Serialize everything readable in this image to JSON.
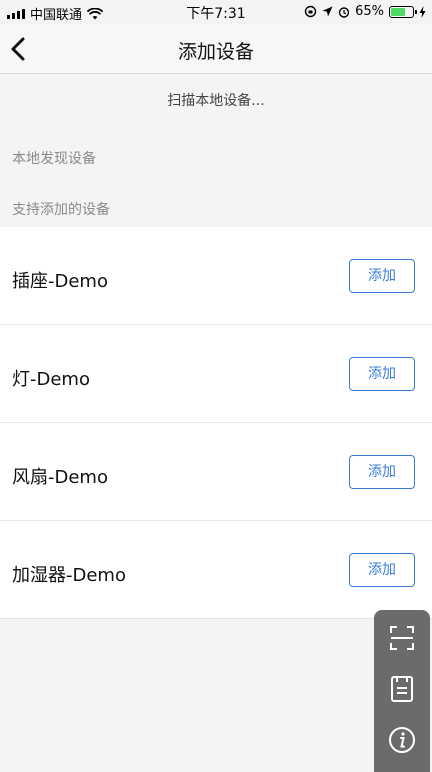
{
  "status_bar": {
    "carrier": "中国联通",
    "time": "下午7:31",
    "battery_percent": "65%",
    "battery_level": 0.65,
    "battery_color": "#4cd964"
  },
  "nav": {
    "title": "添加设备",
    "back_icon": "chevron-left-icon"
  },
  "scan_status": "扫描本地设备...",
  "sections": {
    "local_found": "本地发现设备",
    "supported": "支持添加的设备"
  },
  "devices": [
    {
      "name": "插座-Demo",
      "button": "添加"
    },
    {
      "name": "灯-Demo",
      "button": "添加"
    },
    {
      "name": "风扇-Demo",
      "button": "添加"
    },
    {
      "name": "加湿器-Demo",
      "button": "添加"
    }
  ],
  "toolbar_icons": [
    "scan-icon",
    "notes-icon",
    "info-icon"
  ],
  "colors": {
    "accent": "#3b7dd8",
    "toolbar_bg": "#6b6b6b",
    "page_bg": "#f4f4f4"
  }
}
